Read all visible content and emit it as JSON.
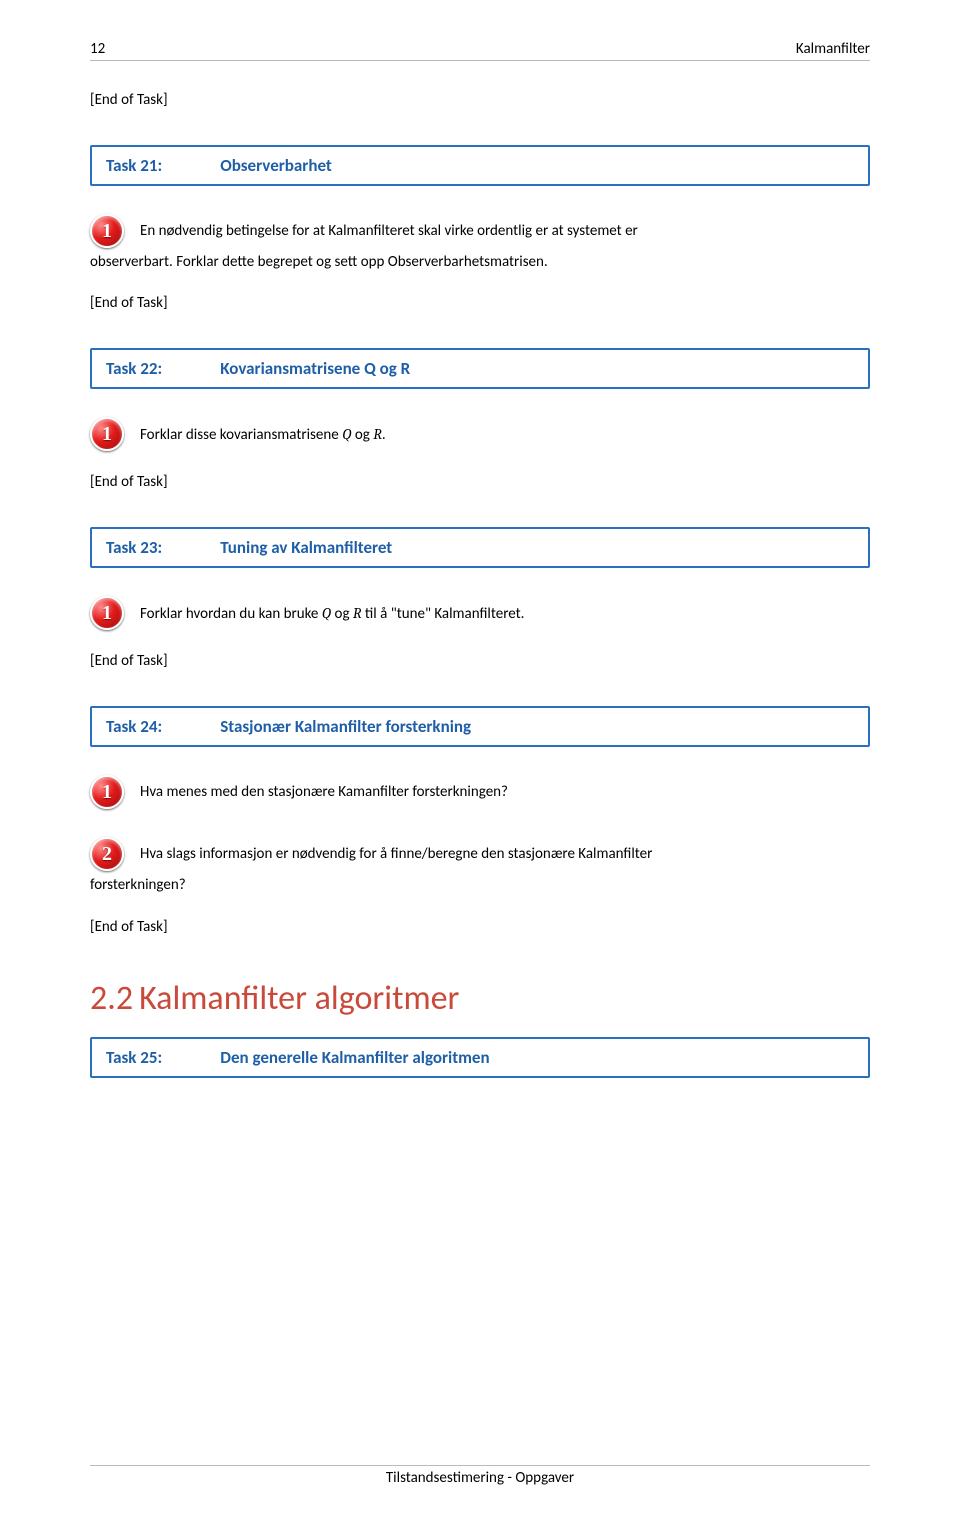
{
  "header": {
    "page_num": "12",
    "chapter": "Kalmanfilter"
  },
  "end_task": "[End of Task]",
  "tasks": [
    {
      "label": "Task 21:",
      "title": "Observerbarhet",
      "items": [
        {
          "badge": "1",
          "text": "En nødvendig betingelse for at Kalmanfilteret skal virke ordentlig er at systemet er",
          "cont": "observerbart. Forklar dette begrepet og sett opp Observerbarhetsmatrisen."
        }
      ]
    },
    {
      "label": "Task 22:",
      "title": "Kovariansmatrisene Q og R",
      "items": [
        {
          "badge": "1",
          "text_pre": "Forklar disse kovariansmatrisene ",
          "m1": "Q",
          "mid": "  og  ",
          "m2": "R",
          "text_post": "."
        }
      ]
    },
    {
      "label": "Task 23:",
      "title": "Tuning av Kalmanfilteret",
      "items": [
        {
          "badge": "1",
          "text_pre": "Forklar hvordan du kan bruke ",
          "m1": "Q",
          "mid": "  og  ",
          "m2": "R",
          "text_post": "  til å \"tune\" Kalmanfilteret."
        }
      ]
    },
    {
      "label": "Task 24:",
      "title": "Stasjonær Kalmanfilter forsterkning",
      "items": [
        {
          "badge": "1",
          "text": "Hva menes med den stasjonære Kamanfilter forsterkningen?"
        },
        {
          "badge": "2",
          "text": "Hva slags informasjon er nødvendig for å finne/beregne den stasjonære Kalmanfilter",
          "cont": "forsterkningen?"
        }
      ]
    },
    {
      "label": "Task 25:",
      "title": "Den generelle Kalmanfilter algoritmen",
      "no_end": true
    }
  ],
  "section": {
    "num": "2.2",
    "title": "Kalmanfilter algoritmer"
  },
  "footer": "Tilstandsestimering - Oppgaver"
}
